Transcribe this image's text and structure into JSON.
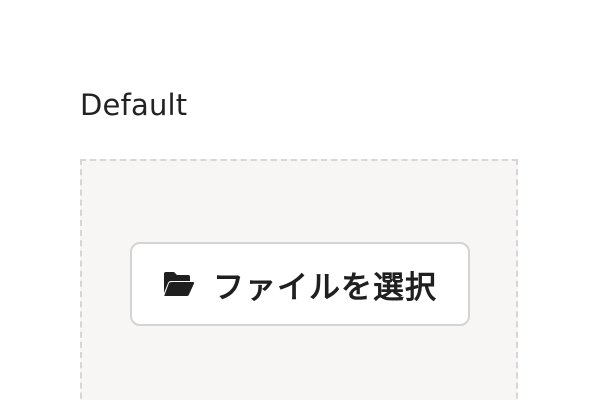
{
  "section": {
    "label": "Default"
  },
  "uploader": {
    "button_label": "ファイルを選択",
    "icon": "folder-open-icon"
  },
  "colors": {
    "dropzone_background": "#f7f6f4",
    "dropzone_border": "#d6d6d6",
    "button_border": "#d4d4d4",
    "text": "#1f1f1f"
  }
}
